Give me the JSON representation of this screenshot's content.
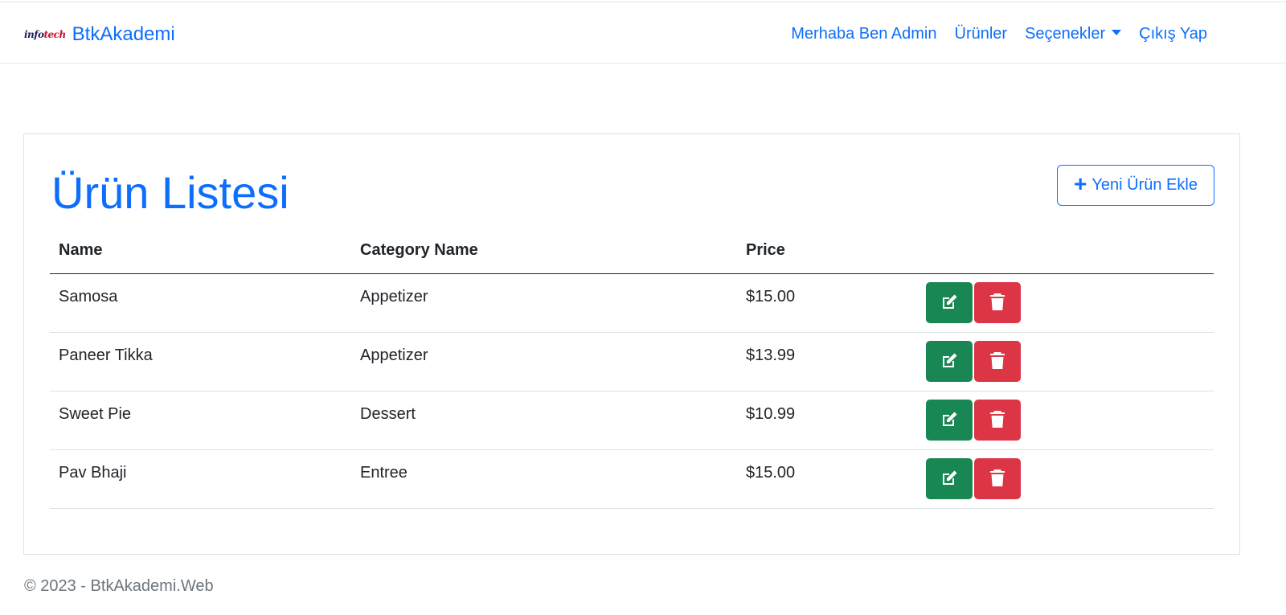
{
  "navbar": {
    "logo_text_1": "info",
    "logo_text_2": "tech",
    "brand": "BtkAkademi",
    "links": {
      "greeting": "Merhaba Ben Admin",
      "products": "Ürünler",
      "options": "Seçenekler",
      "logout": "Çıkış Yap"
    }
  },
  "main": {
    "title": "Ürün Listesi",
    "add_button_label": "Yeni Ürün Ekle",
    "table": {
      "headers": [
        "Name",
        "Category Name",
        "Price",
        ""
      ],
      "rows": [
        {
          "name": "Samosa",
          "category": "Appetizer",
          "price": "$15.00"
        },
        {
          "name": "Paneer Tikka",
          "category": "Appetizer",
          "price": "$13.99"
        },
        {
          "name": "Sweet Pie",
          "category": "Dessert",
          "price": "$10.99"
        },
        {
          "name": "Pav Bhaji",
          "category": "Entree",
          "price": "$15.00"
        }
      ]
    }
  },
  "footer": {
    "text": "© 2023 - BtkAkademi.Web"
  },
  "colors": {
    "primary": "#0d6efd",
    "success": "#198754",
    "danger": "#dc3545",
    "muted": "#6c757d"
  },
  "icons": {
    "edit": "edit-icon",
    "delete": "trash-icon",
    "add": "plus-icon",
    "dropdown": "caret-down-icon"
  }
}
